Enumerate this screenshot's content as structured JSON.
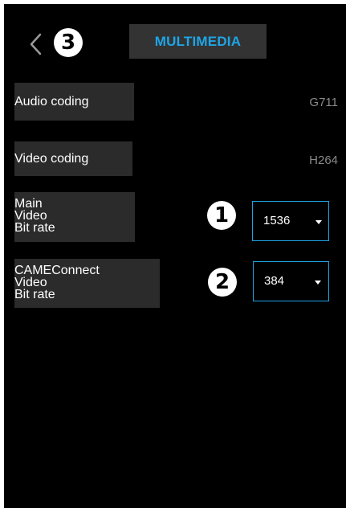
{
  "header": {
    "title": "MULTIMEDIA",
    "back_icon": "chevron-left-icon",
    "step_callout": "3"
  },
  "rows": {
    "audio": {
      "label": "Audio coding",
      "value": "G711"
    },
    "video": {
      "label": "Video coding",
      "value": "H264"
    },
    "main_bitrate": {
      "label_lines": [
        "Main",
        "Video",
        "Bit rate"
      ],
      "callout": "1",
      "selected": "1536"
    },
    "came_bitrate": {
      "label_lines": [
        "CAMEConnect",
        "Video",
        "Bit rate"
      ],
      "callout": "2",
      "selected": "384"
    }
  },
  "colors": {
    "accent": "#1ea5e6",
    "background": "#000000",
    "label_bg": "#2b2b2b",
    "value_gray": "#8a8a8a"
  }
}
